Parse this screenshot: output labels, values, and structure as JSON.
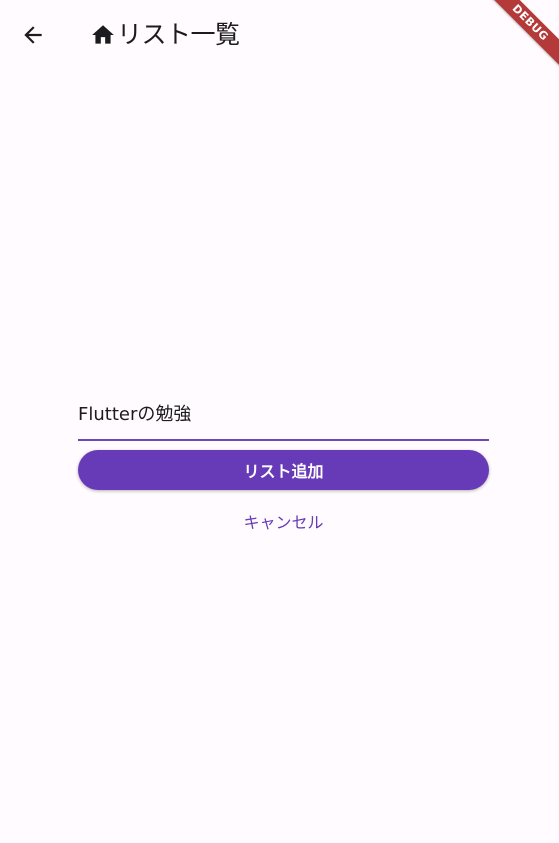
{
  "app_bar": {
    "back_icon": "arrow-back-icon",
    "home_icon": "home-icon",
    "title": "リスト一覧"
  },
  "debug_banner": {
    "label": "DEBUG",
    "color": "#b43a3a"
  },
  "form": {
    "input_value": "Flutterの勉強",
    "add_button_label": "リスト追加",
    "cancel_button_label": "キャンセル"
  },
  "colors": {
    "primary": "#673ab7",
    "background": "#fffbfe",
    "text": "#1c1b1f"
  }
}
